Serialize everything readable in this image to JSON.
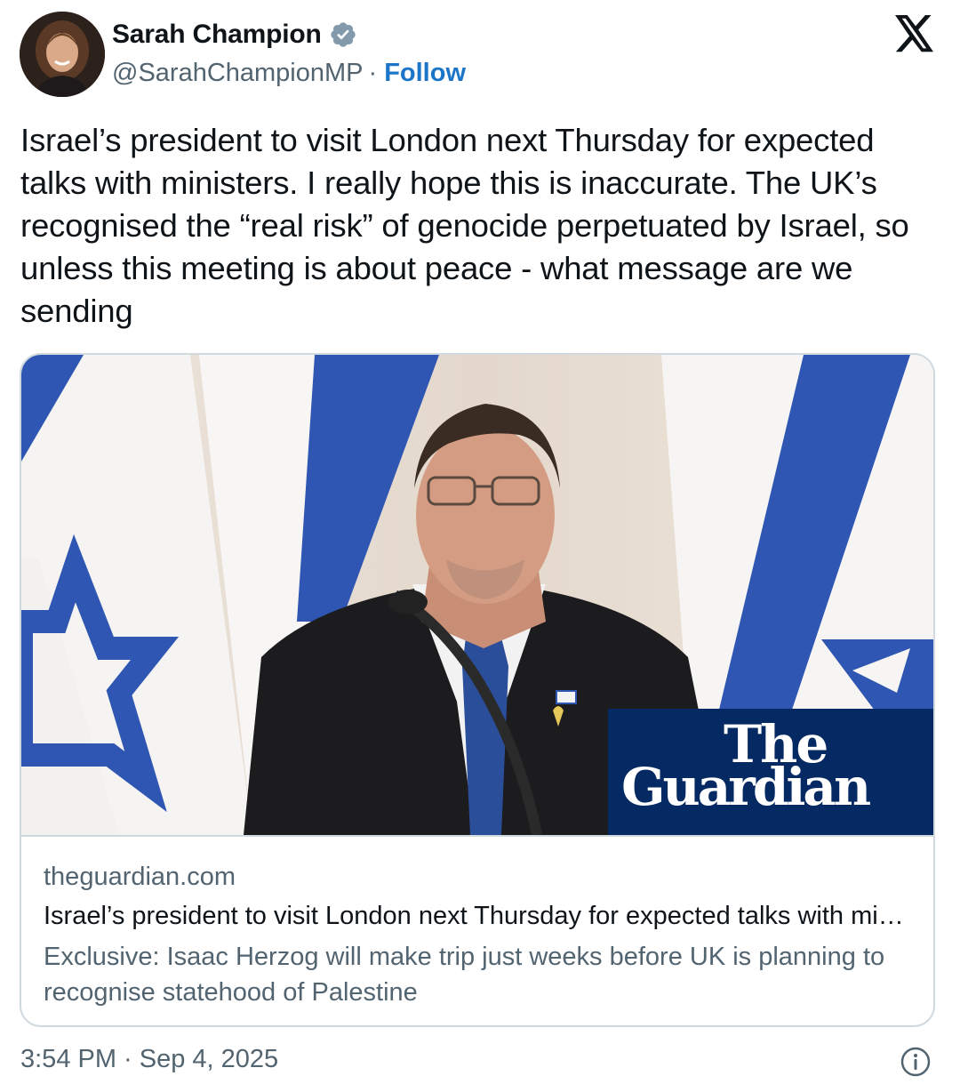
{
  "author": {
    "display_name": "Sarah Champion",
    "handle": "@SarahChampionMP",
    "separator": "·",
    "follow_label": "Follow",
    "verified": true,
    "avatar_icon": "profile-photo"
  },
  "header": {
    "platform_icon": "x-logo-icon"
  },
  "tweet": {
    "text": "Israel’s president to visit London next Thursday for expected talks with ministers. I really hope this is inaccurate. The UK’s recognised the “real risk” of genocide perpetuated by Israel, so unless this meeting is about peace - what message are we sending"
  },
  "link_card": {
    "image_logo_line1": "The",
    "image_logo_line2": "Guardian",
    "domain": "theguardian.com",
    "title": "Israel’s president to visit London next Thursday for expected talks with ministers",
    "description": "Exclusive: Isaac Herzog will make trip just weeks before UK is planning to recognise statehood of Palestine"
  },
  "footer": {
    "timestamp": "3:54 PM · Sep 4, 2025",
    "info_icon": "info-icon"
  },
  "colors": {
    "link_blue": "#1d75c8",
    "muted_text": "#536471",
    "border": "#cfd9de",
    "guardian_navy": "#052962",
    "flag_blue": "#2f56b3"
  }
}
